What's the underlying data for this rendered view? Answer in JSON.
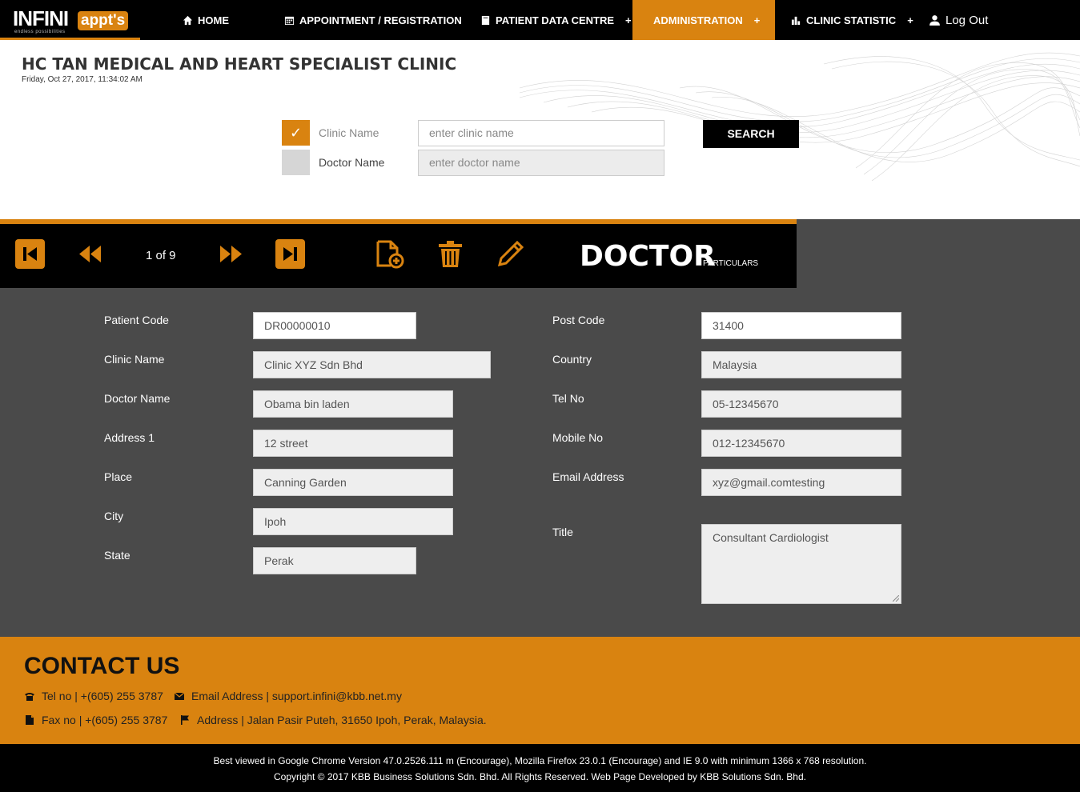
{
  "nav": {
    "logo_main": "INFINI",
    "logo_badge": "appt's",
    "logo_tagline": "endless possibilities",
    "home": "HOME",
    "appointment": "APPOINTMENT / REGISTRATION",
    "patient_data": "PATIENT DATA CENTRE",
    "administration": "ADMINISTRATION",
    "clinic_statistic": "CLINIC STATISTIC",
    "logout": "Log Out",
    "plus": "+"
  },
  "header": {
    "title": "HC TAN MEDICAL AND HEART SPECIALIST CLINIC",
    "datetime": "Friday, Oct 27, 2017, 11:34:02 AM"
  },
  "search": {
    "clinic_label": "Clinic Name",
    "clinic_placeholder": "enter clinic name",
    "clinic_checked": true,
    "checkmark": "✓",
    "doctor_label": "Doctor Name",
    "doctor_placeholder": "enter doctor name",
    "doctor_checked": false,
    "button": "SEARCH"
  },
  "toolbar": {
    "pager": "1 of 9",
    "title": "DOCTOR",
    "subtitle": "PARTICULARS",
    "icon_color": "#d98310"
  },
  "form": {
    "left": [
      {
        "label": "Patient Code",
        "value": "DR00000010"
      },
      {
        "label": "Clinic Name",
        "value": "Clinic XYZ Sdn Bhd"
      },
      {
        "label": "Doctor Name",
        "value": "Obama bin laden"
      },
      {
        "label": "Address 1",
        "value": "12 street"
      },
      {
        "label": "Place",
        "value": "Canning Garden"
      },
      {
        "label": "City",
        "value": "Ipoh"
      },
      {
        "label": "State",
        "value": "Perak"
      }
    ],
    "right": [
      {
        "label": "Post Code",
        "value": "31400"
      },
      {
        "label": "Country",
        "value": "Malaysia"
      },
      {
        "label": "Tel No",
        "value": "05-12345670"
      },
      {
        "label": "Mobile No",
        "value": "012-12345670"
      },
      {
        "label": "Email Address",
        "value": "xyz@gmail.comtesting"
      },
      {
        "label": "Title",
        "value": "Consultant Cardiologist"
      }
    ]
  },
  "contact": {
    "heading": "CONTACT US",
    "tel": "Tel no | +(605) 255 3787",
    "email": "Email Address | support.infini@kbb.net.my",
    "fax": "Fax no | +(605) 255 3787",
    "address": "Address | Jalan Pasir Puteh, 31650 Ipoh, Perak, Malaysia."
  },
  "footer": {
    "line1": "Best viewed in Google Chrome Version 47.0.2526.111 m (Encourage), Mozilla Firefox 23.0.1 (Encourage) and IE 9.0 with minimum 1366 x 768 resolution.",
    "line2": "Copyright © 2017 KBB Business Solutions Sdn. Bhd. All Rights Reserved. Web Page Developed by KBB Solutions Sdn. Bhd."
  },
  "colors": {
    "accent": "#d98310",
    "dark": "#4a4a4a"
  }
}
